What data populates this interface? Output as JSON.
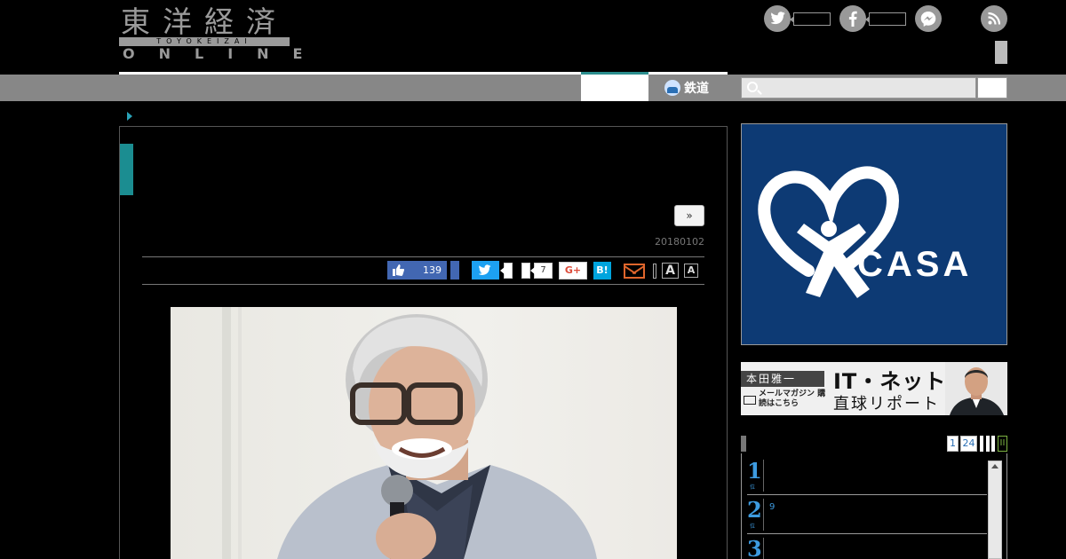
{
  "header": {
    "logo": {
      "kanji": "東洋経済",
      "band": "TOYOKEIZAI",
      "online": "ONLINE"
    }
  },
  "nav": {
    "railway_label": "鉄道",
    "search": {
      "placeholder": ""
    }
  },
  "article": {
    "next_label": "»",
    "date": "20180102",
    "share": {
      "facebook_count": "139",
      "pocket_count": "7",
      "gplus_label": "G+",
      "hatena_label": "B!",
      "font_large_label": "A",
      "font_small_label": "A"
    }
  },
  "sidebar": {
    "ad_casa": {
      "word": "CASA",
      "reg": "®"
    },
    "it_banner": {
      "author": "本田雅一",
      "mail_text": "メールマガジン 購読はこちら",
      "title_line1": "IT・ネット",
      "title_line2": "直球リポート"
    },
    "ranking": {
      "tabs": [
        "1",
        "24"
      ],
      "green_tab": "II",
      "items": [
        {
          "rank": "1",
          "sub": "位",
          "text": ""
        },
        {
          "rank": "2",
          "sub": "位",
          "text": "9"
        },
        {
          "rank": "3",
          "sub": "位",
          "text": ""
        }
      ]
    }
  },
  "colors": {
    "accent_teal": "#1b8d91",
    "nav_gray": "#878787",
    "facebook": "#4267b2",
    "twitter": "#1da1f2",
    "hatena": "#00a4de",
    "casa_navy": "#0d3a74",
    "rank_blue": "#3d9be0"
  }
}
